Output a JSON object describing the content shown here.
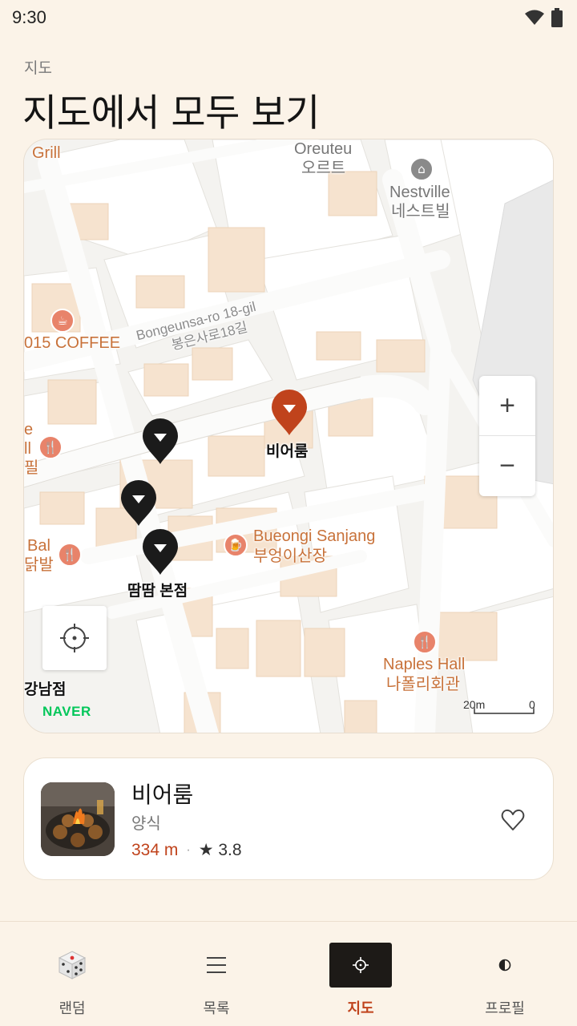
{
  "status_bar": {
    "time": "9:30",
    "wifi_icon": "wifi-icon",
    "battery_icon": "battery-icon"
  },
  "header": {
    "eyebrow": "지도",
    "title": "지도에서 모두 보기"
  },
  "map": {
    "labels": {
      "grill": "Grill",
      "oreuteu_en": "Oreuteu",
      "oreuteu_ko": "오르트",
      "nestville_en": "Nestville",
      "nestville_ko": "네스트빌",
      "road_en": "Bongeunsa-ro 18-gil",
      "road_ko": "봉은사로18길",
      "coffee": "015 COFFEE",
      "e_fragment": "e",
      "ll_fragment": "ll",
      "pil_fragment": "필",
      "bal_en": "Bal",
      "bal_ko": "닭발",
      "bueongi_en": "Bueongi Sanjang",
      "bueongi_ko": "부엉이산장",
      "naples_en": "Naples Hall",
      "naples_ko": "나폴리회관",
      "gangnam": "강남점"
    },
    "pins": {
      "selected_label": "비어룸",
      "ttamttam_label": "땀땀 본점"
    },
    "zoom_in": "+",
    "zoom_out": "−",
    "locate_icon": "crosshair-icon",
    "logo": "NAVER",
    "scale": {
      "left": "20m",
      "right": "0"
    }
  },
  "place_card": {
    "name": "비어룸",
    "category": "양식",
    "distance": "334 m",
    "separator": "·",
    "rating": "★ 3.8",
    "favorite_icon": "heart-outline-icon"
  },
  "bottom_nav": {
    "items": [
      {
        "label": "랜덤",
        "icon": "dice-icon",
        "active": false
      },
      {
        "label": "목록",
        "icon": "list-icon",
        "active": false
      },
      {
        "label": "지도",
        "icon": "crosshair-icon",
        "active": true
      },
      {
        "label": "프로필",
        "icon": "half-circle-icon",
        "active": false
      }
    ]
  },
  "colors": {
    "accent": "#c0431c",
    "background": "#fbf3e8",
    "naver_green": "#03c75a",
    "active_nav_bg": "#1d1a17"
  }
}
